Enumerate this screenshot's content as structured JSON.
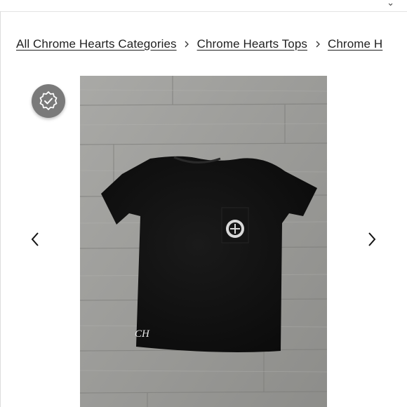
{
  "breadcrumb": {
    "items": [
      {
        "label": "All Chrome Hearts Categories"
      },
      {
        "label": "Chrome Hearts Tops"
      },
      {
        "label": "Chrome H"
      }
    ]
  },
  "gallery": {
    "image_subject": "black t-shirt photo on wood floor",
    "shirt_text": "CH",
    "badge_icon": "verified-check-icon",
    "prev_icon": "chevron-left-icon",
    "next_icon": "chevron-right-icon"
  },
  "colors": {
    "floor": "#9a9a97",
    "shirt": "#0f0f0f",
    "badge": "#7a7a7a"
  }
}
